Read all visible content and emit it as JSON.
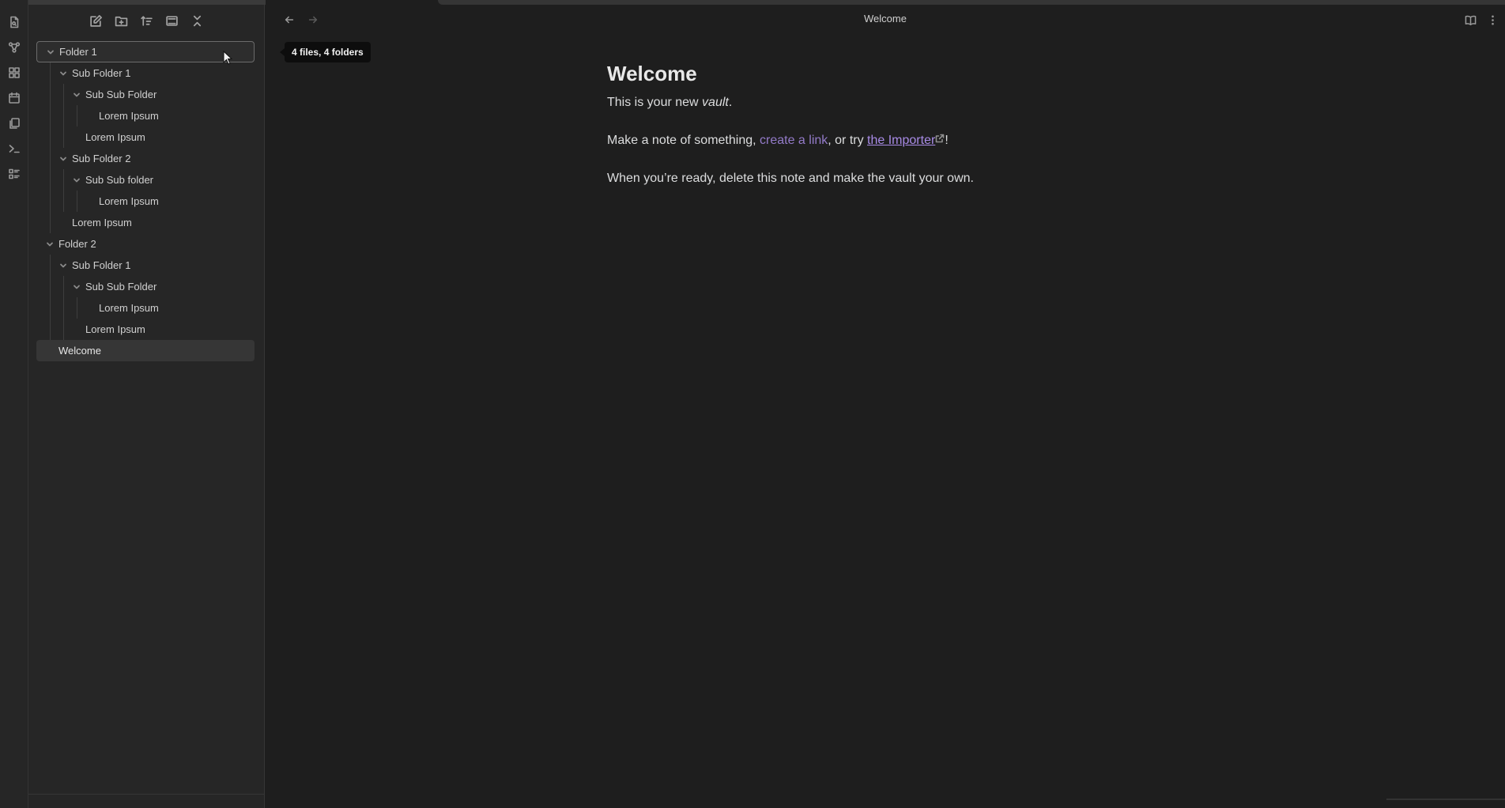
{
  "ribbon": {
    "icons": [
      "file-icon",
      "graph-icon",
      "grid-icon",
      "calendar-icon",
      "pages-icon",
      "terminal-icon",
      "list-icon"
    ]
  },
  "sidebar": {
    "header_icons": [
      "new-note-icon",
      "new-folder-icon",
      "sort-icon",
      "layout-icon",
      "collapse-icon"
    ],
    "tree": [
      {
        "label": "Folder 1",
        "depth": 0,
        "folder": true
      },
      {
        "label": "Sub Folder 1",
        "depth": 1,
        "folder": true
      },
      {
        "label": "Sub Sub Folder",
        "depth": 2,
        "folder": true
      },
      {
        "label": "Lorem Ipsum",
        "depth": 3,
        "folder": false
      },
      {
        "label": "Lorem Ipsum",
        "depth": 2,
        "folder": false
      },
      {
        "label": "Sub Folder 2",
        "depth": 1,
        "folder": true
      },
      {
        "label": "Sub Sub folder",
        "depth": 2,
        "folder": true
      },
      {
        "label": "Lorem Ipsum",
        "depth": 3,
        "folder": false
      },
      {
        "label": "Lorem Ipsum",
        "depth": 1,
        "folder": false
      },
      {
        "label": "Folder 2",
        "depth": 0,
        "folder": true
      },
      {
        "label": "Sub Folder 1",
        "depth": 1,
        "folder": true
      },
      {
        "label": "Sub Sub Folder",
        "depth": 2,
        "folder": true
      },
      {
        "label": "Lorem Ipsum",
        "depth": 3,
        "folder": false
      },
      {
        "label": "Lorem Ipsum",
        "depth": 2,
        "folder": false
      },
      {
        "label": "Welcome",
        "depth": 0,
        "folder": false
      }
    ],
    "focused_index": 0,
    "active_index": 14
  },
  "tooltip": {
    "text": "4 files, 4 folders"
  },
  "view": {
    "title": "Welcome"
  },
  "note": {
    "heading": "Welcome",
    "line1_prefix": "This is your new ",
    "line1_em": "vault",
    "line1_suffix": ".",
    "line2_prefix": "Make a note of something, ",
    "line2_link_internal": "create a link",
    "line2_middle": ", or try ",
    "line2_link_external": "the Importer",
    "line2_suffix": "!",
    "line3": "When you’re ready, delete this note and make the vault your own."
  },
  "colors": {
    "accent": "#a88be6",
    "background": "#1e1e1e",
    "sidebar": "#262626"
  }
}
